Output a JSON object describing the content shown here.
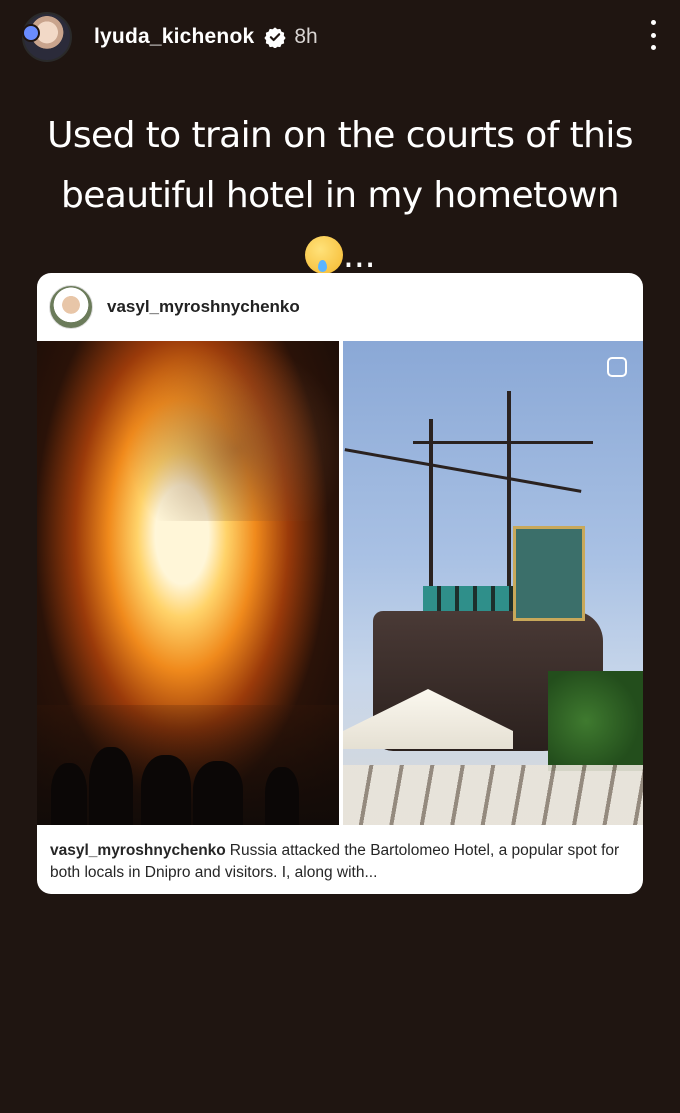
{
  "story": {
    "username": "lyuda_kichenok",
    "time": "8h",
    "caption_text": "Used to train on the courts of this beautiful hotel in my hometown",
    "caption_ellipsis": "...",
    "caption_emoji": "face-holding-back-tears-emoji"
  },
  "shared_post": {
    "username": "vasyl_myroshnychenko",
    "caption_user": "vasyl_myroshnychenko",
    "caption_text": "Russia attacked the Bartolomeo Hotel, a popular spot for both locals in Dnipro and visitors. I, along with...",
    "images": [
      "burning-ship-photo",
      "pirate-ship-hotel-photo"
    ]
  },
  "colors": {
    "background": "#1f1511",
    "card": "#ffffff",
    "verified": "#ffffff"
  }
}
